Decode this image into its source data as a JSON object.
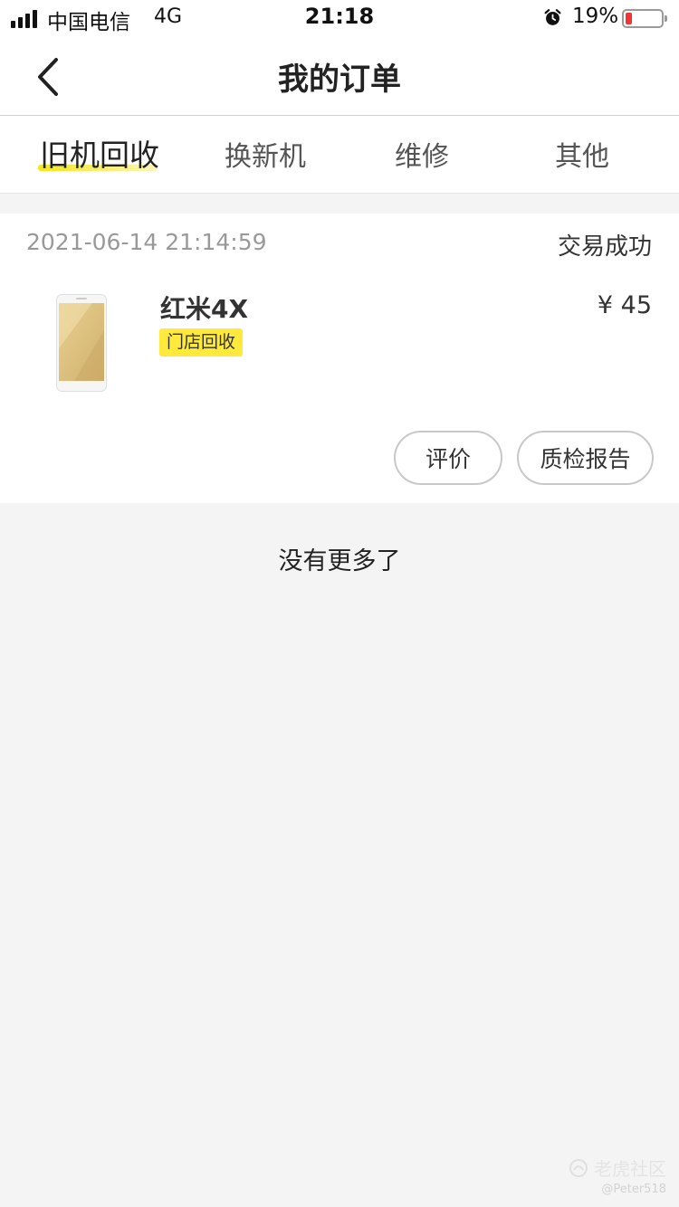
{
  "status_bar": {
    "carrier": "中国电信",
    "network": "4G",
    "time": "21:18",
    "battery": "19%",
    "battery_level": 0.19,
    "battery_color": "#f03535",
    "alarm_icon": "alarm-clock-icon"
  },
  "nav": {
    "title": "我的订单",
    "back_icon": "chevron-left-icon"
  },
  "tabs": {
    "items": [
      {
        "label": "旧机回收",
        "active": true
      },
      {
        "label": "换新机",
        "active": false
      },
      {
        "label": "维修",
        "active": false
      },
      {
        "label": "其他",
        "active": false
      }
    ],
    "active_color": "#f5e61d"
  },
  "orders": [
    {
      "datetime": "2021-06-14 21:14:59",
      "status": "交易成功",
      "product_name": "红米4X",
      "tag": "门店回收",
      "price": "¥ 45",
      "buttons": {
        "rate": "评价",
        "report": "质检报告"
      }
    }
  ],
  "list_end": "没有更多了",
  "watermark": {
    "brand": "老虎社区",
    "user": "@Peter518"
  }
}
